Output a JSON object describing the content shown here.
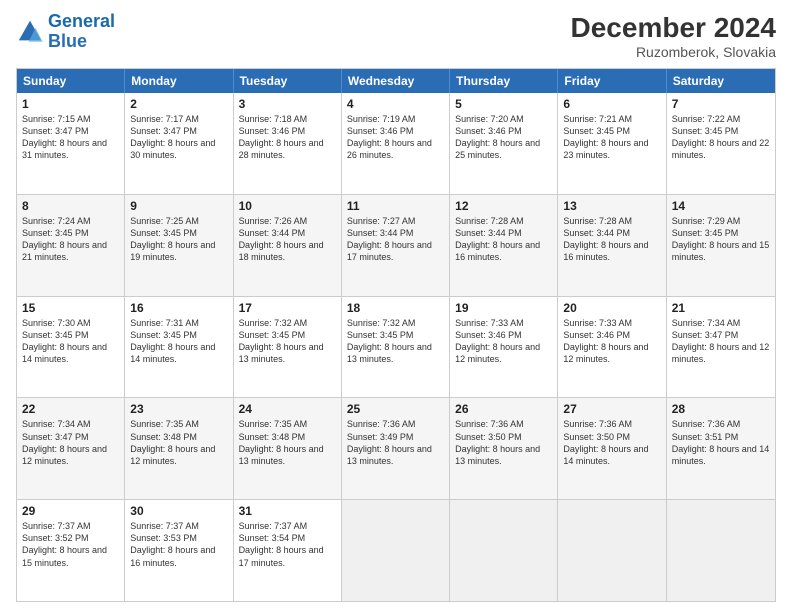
{
  "logo": {
    "line1": "General",
    "line2": "Blue"
  },
  "title": "December 2024",
  "location": "Ruzomberok, Slovakia",
  "days": [
    "Sunday",
    "Monday",
    "Tuesday",
    "Wednesday",
    "Thursday",
    "Friday",
    "Saturday"
  ],
  "weeks": [
    [
      {
        "num": "1",
        "sunrise": "7:15 AM",
        "sunset": "3:47 PM",
        "daylight": "8 hours and 31 minutes."
      },
      {
        "num": "2",
        "sunrise": "7:17 AM",
        "sunset": "3:47 PM",
        "daylight": "8 hours and 30 minutes."
      },
      {
        "num": "3",
        "sunrise": "7:18 AM",
        "sunset": "3:46 PM",
        "daylight": "8 hours and 28 minutes."
      },
      {
        "num": "4",
        "sunrise": "7:19 AM",
        "sunset": "3:46 PM",
        "daylight": "8 hours and 26 minutes."
      },
      {
        "num": "5",
        "sunrise": "7:20 AM",
        "sunset": "3:46 PM",
        "daylight": "8 hours and 25 minutes."
      },
      {
        "num": "6",
        "sunrise": "7:21 AM",
        "sunset": "3:45 PM",
        "daylight": "8 hours and 23 minutes."
      },
      {
        "num": "7",
        "sunrise": "7:22 AM",
        "sunset": "3:45 PM",
        "daylight": "8 hours and 22 minutes."
      }
    ],
    [
      {
        "num": "8",
        "sunrise": "7:24 AM",
        "sunset": "3:45 PM",
        "daylight": "8 hours and 21 minutes."
      },
      {
        "num": "9",
        "sunrise": "7:25 AM",
        "sunset": "3:45 PM",
        "daylight": "8 hours and 19 minutes."
      },
      {
        "num": "10",
        "sunrise": "7:26 AM",
        "sunset": "3:44 PM",
        "daylight": "8 hours and 18 minutes."
      },
      {
        "num": "11",
        "sunrise": "7:27 AM",
        "sunset": "3:44 PM",
        "daylight": "8 hours and 17 minutes."
      },
      {
        "num": "12",
        "sunrise": "7:28 AM",
        "sunset": "3:44 PM",
        "daylight": "8 hours and 16 minutes."
      },
      {
        "num": "13",
        "sunrise": "7:28 AM",
        "sunset": "3:44 PM",
        "daylight": "8 hours and 16 minutes."
      },
      {
        "num": "14",
        "sunrise": "7:29 AM",
        "sunset": "3:45 PM",
        "daylight": "8 hours and 15 minutes."
      }
    ],
    [
      {
        "num": "15",
        "sunrise": "7:30 AM",
        "sunset": "3:45 PM",
        "daylight": "8 hours and 14 minutes."
      },
      {
        "num": "16",
        "sunrise": "7:31 AM",
        "sunset": "3:45 PM",
        "daylight": "8 hours and 14 minutes."
      },
      {
        "num": "17",
        "sunrise": "7:32 AM",
        "sunset": "3:45 PM",
        "daylight": "8 hours and 13 minutes."
      },
      {
        "num": "18",
        "sunrise": "7:32 AM",
        "sunset": "3:45 PM",
        "daylight": "8 hours and 13 minutes."
      },
      {
        "num": "19",
        "sunrise": "7:33 AM",
        "sunset": "3:46 PM",
        "daylight": "8 hours and 12 minutes."
      },
      {
        "num": "20",
        "sunrise": "7:33 AM",
        "sunset": "3:46 PM",
        "daylight": "8 hours and 12 minutes."
      },
      {
        "num": "21",
        "sunrise": "7:34 AM",
        "sunset": "3:47 PM",
        "daylight": "8 hours and 12 minutes."
      }
    ],
    [
      {
        "num": "22",
        "sunrise": "7:34 AM",
        "sunset": "3:47 PM",
        "daylight": "8 hours and 12 minutes."
      },
      {
        "num": "23",
        "sunrise": "7:35 AM",
        "sunset": "3:48 PM",
        "daylight": "8 hours and 12 minutes."
      },
      {
        "num": "24",
        "sunrise": "7:35 AM",
        "sunset": "3:48 PM",
        "daylight": "8 hours and 13 minutes."
      },
      {
        "num": "25",
        "sunrise": "7:36 AM",
        "sunset": "3:49 PM",
        "daylight": "8 hours and 13 minutes."
      },
      {
        "num": "26",
        "sunrise": "7:36 AM",
        "sunset": "3:50 PM",
        "daylight": "8 hours and 13 minutes."
      },
      {
        "num": "27",
        "sunrise": "7:36 AM",
        "sunset": "3:50 PM",
        "daylight": "8 hours and 14 minutes."
      },
      {
        "num": "28",
        "sunrise": "7:36 AM",
        "sunset": "3:51 PM",
        "daylight": "8 hours and 14 minutes."
      }
    ],
    [
      {
        "num": "29",
        "sunrise": "7:37 AM",
        "sunset": "3:52 PM",
        "daylight": "8 hours and 15 minutes."
      },
      {
        "num": "30",
        "sunrise": "7:37 AM",
        "sunset": "3:53 PM",
        "daylight": "8 hours and 16 minutes."
      },
      {
        "num": "31",
        "sunrise": "7:37 AM",
        "sunset": "3:54 PM",
        "daylight": "8 hours and 17 minutes."
      },
      null,
      null,
      null,
      null
    ]
  ]
}
